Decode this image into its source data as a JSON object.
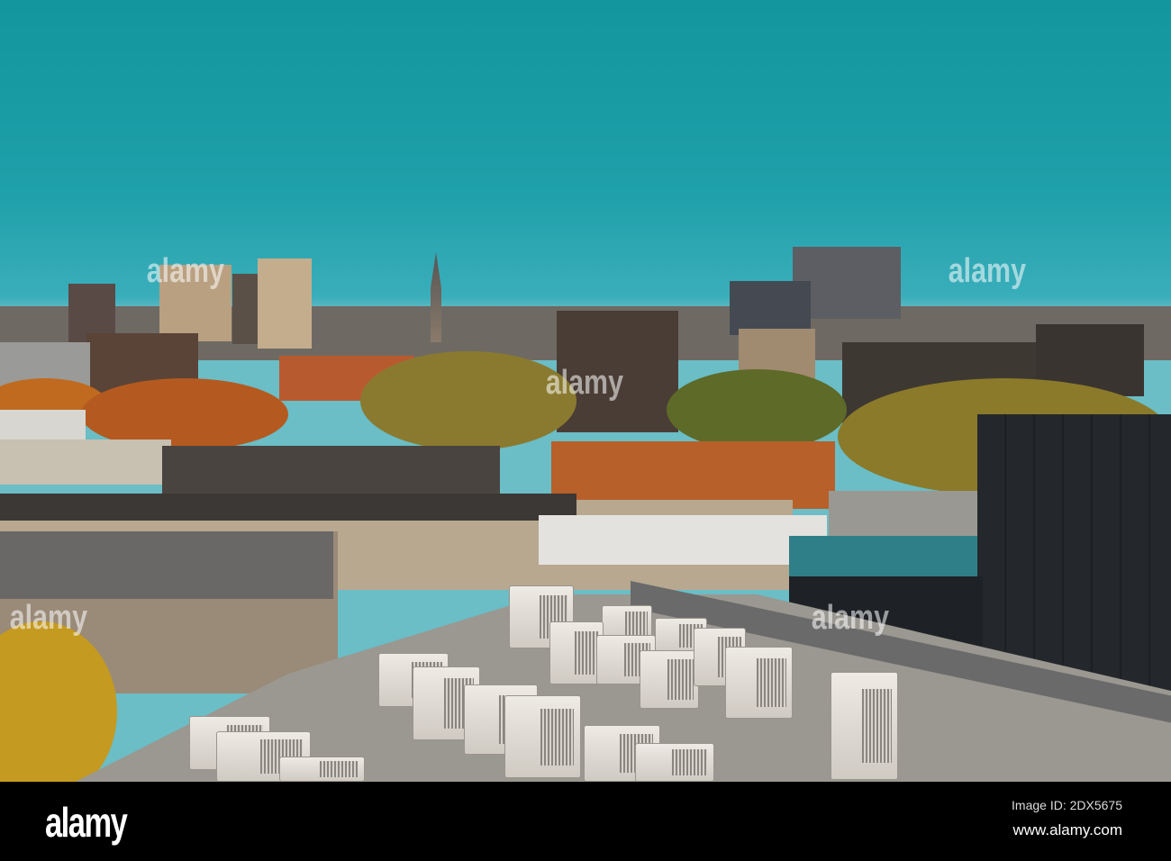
{
  "watermark": {
    "logo": "alamy",
    "image_id": "Image ID: 2DX5675",
    "url": "www.alamy.com"
  },
  "colors": {
    "sky": "#1a9ba4",
    "footer": "#000000"
  }
}
